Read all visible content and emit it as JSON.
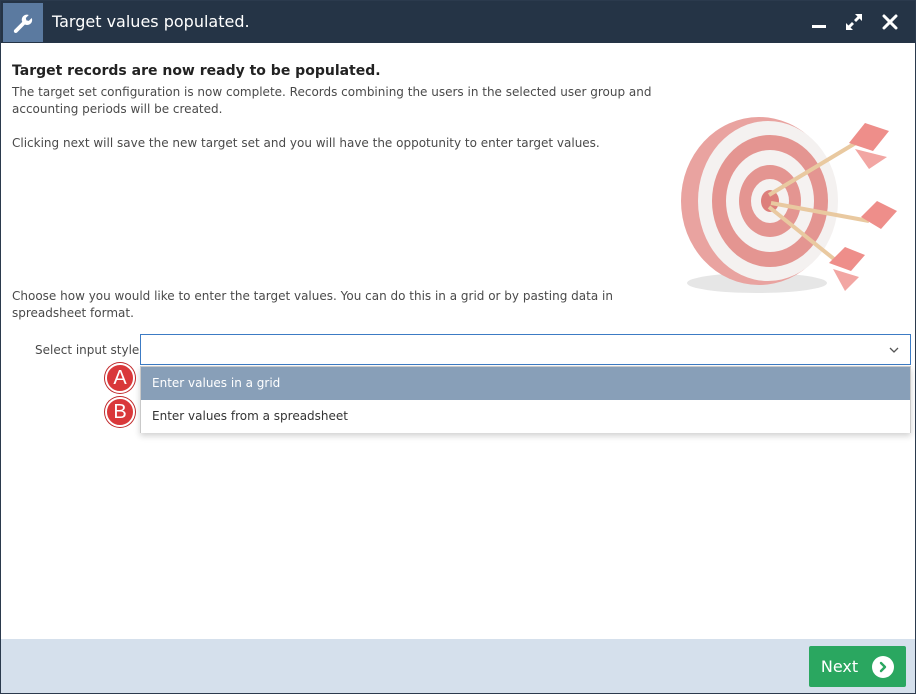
{
  "window": {
    "title": "Target values populated.",
    "icon": "wrench-icon",
    "controls": [
      "minimize-icon",
      "maximize-icon",
      "close-icon"
    ]
  },
  "content": {
    "heading": "Target records are now ready to be populated.",
    "paragraph1": "The target set configuration is now complete. Records combining the users in the selected user group and accounting periods will be created.",
    "paragraph2": "Clicking next will save the new target set and you will have the oppotunity to enter target values.",
    "paragraph3": "Choose how you would like to enter the target values. You can do this in a grid or by pasting data in spreadsheet format.",
    "select": {
      "label": "Select input style",
      "value": "",
      "options": [
        {
          "label": "Enter values in a grid",
          "badge": "A",
          "selected": true
        },
        {
          "label": "Enter values from a spreadsheet",
          "badge": "B",
          "selected": false
        }
      ]
    }
  },
  "footer": {
    "next_label": "Next",
    "next_icon": "chevron-right-circle-icon"
  },
  "colors": {
    "titlebar": "#253446",
    "accent": "#3c7bc4",
    "selected_option": "#889fb8",
    "badge": "#d9383a",
    "next_button": "#2aa760",
    "footer": "#d5e0ec"
  }
}
